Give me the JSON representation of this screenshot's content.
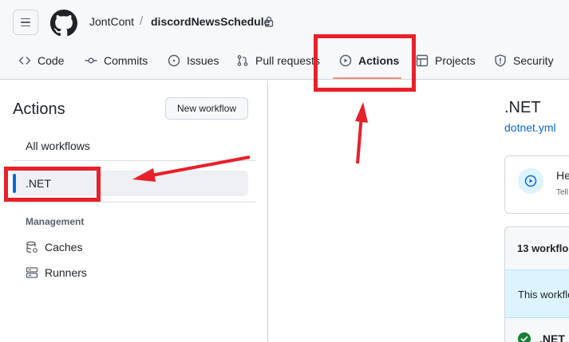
{
  "header": {
    "owner": "JontCont",
    "separator": "/",
    "repo": "discordNewsSchedule"
  },
  "tabs": [
    {
      "label": "Code",
      "icon": "code-icon"
    },
    {
      "label": "Commits",
      "icon": "commit-icon"
    },
    {
      "label": "Issues",
      "icon": "issue-icon"
    },
    {
      "label": "Pull requests",
      "icon": "pull-request-icon"
    },
    {
      "label": "Actions",
      "icon": "play-icon",
      "active": true
    },
    {
      "label": "Projects",
      "icon": "table-icon"
    },
    {
      "label": "Security",
      "icon": "shield-icon"
    }
  ],
  "sidebar": {
    "title": "Actions",
    "new_workflow_label": "New workflow",
    "all_workflows_label": "All workflows",
    "workflows": [
      ".NET"
    ],
    "management_heading": "Management",
    "management_items": [
      {
        "label": "Caches",
        "icon": "database-icon"
      },
      {
        "label": "Runners",
        "icon": "server-icon"
      }
    ]
  },
  "main": {
    "workflow_title": ".NET",
    "workflow_file": "dotnet.yml",
    "card_title": "He",
    "card_subtitle": "Tell",
    "runs_count_label": "13 workflo",
    "info_text": "This workflo",
    "run_name": ".NET"
  },
  "colors": {
    "accent_blue": "#0969da",
    "active_underline": "#fd8c73",
    "annotation_red": "#e8202a",
    "success_green": "#1a7f37"
  }
}
